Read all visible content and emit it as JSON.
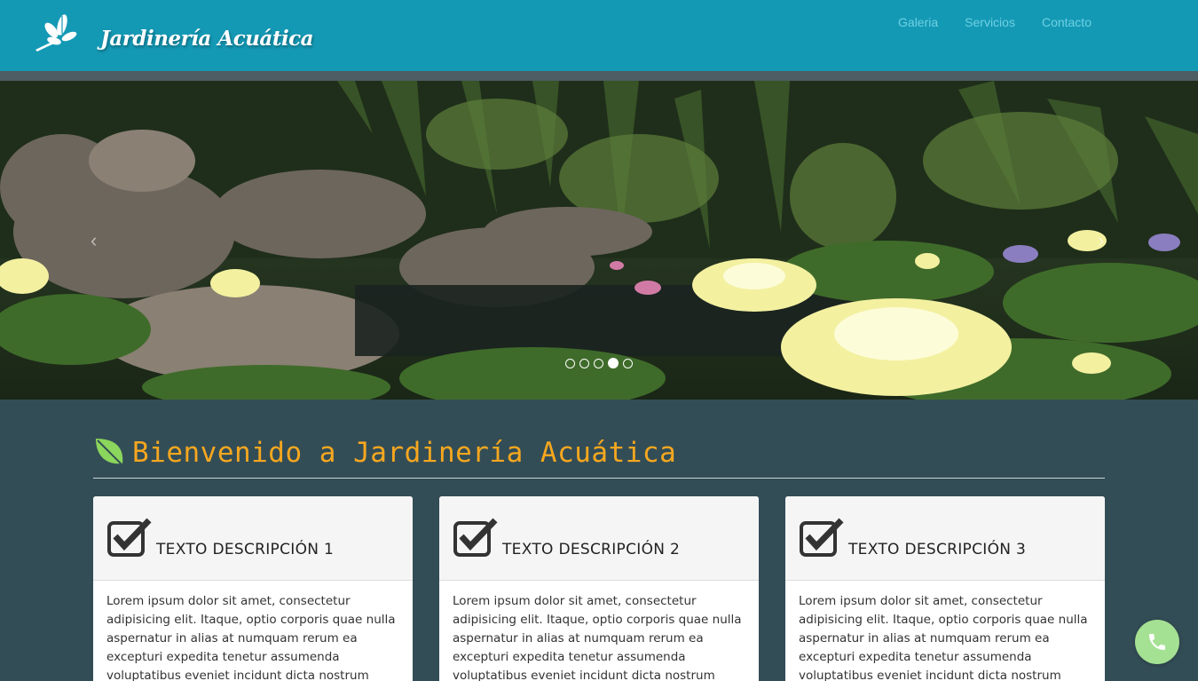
{
  "header": {
    "brand": "Jardinería Acuática",
    "logo_icon": "flower-leaf-logo-icon",
    "nav": [
      {
        "label": "Galeria"
      },
      {
        "label": "Servicios"
      },
      {
        "label": "Contacto"
      }
    ],
    "colors": {
      "bar": "#1499b5",
      "nav_text": "#6fd0e3"
    }
  },
  "hero": {
    "image": "water-garden-pond-with-yellow-water-lilies",
    "prev_icon": "chevron-left-icon",
    "next_icon": "chevron-right-icon",
    "prev_glyph": "‹",
    "next_glyph": "›",
    "slide_count": 5,
    "active_slide": 4
  },
  "welcome": {
    "title": "Bienvenido a Jardinería Acuática",
    "icon": "leaf-icon",
    "title_color": "#f6a71f"
  },
  "cards": [
    {
      "title": "TEXTO DESCRIPCIÓN 1",
      "icon": "checkbox-check-icon",
      "body": "Lorem ipsum dolor sit amet, consectetur adipisicing elit. Itaque, optio corporis quae nulla aspernatur in alias at numquam rerum ea excepturi expedita tenetur assumenda voluptatibus eveniet incidunt dicta nostrum quod?"
    },
    {
      "title": "TEXTO DESCRIPCIÓN 2",
      "icon": "checkbox-check-icon",
      "body": "Lorem ipsum dolor sit amet, consectetur adipisicing elit. Itaque, optio corporis quae nulla aspernatur in alias at numquam rerum ea excepturi expedita tenetur assumenda voluptatibus eveniet incidunt dicta nostrum quod?"
    },
    {
      "title": "TEXTO DESCRIPCIÓN 3",
      "icon": "checkbox-check-icon",
      "body": "Lorem ipsum dolor sit amet, consectetur adipisicing elit. Itaque, optio corporis quae nulla aspernatur in alias at numquam rerum ea excepturi expedita tenetur assumenda voluptatibus eveniet incidunt dicta nostrum quod?"
    }
  ],
  "phone_button": {
    "icon": "phone-icon",
    "color": "#a5e193"
  },
  "page": {
    "background": "#334d56"
  }
}
